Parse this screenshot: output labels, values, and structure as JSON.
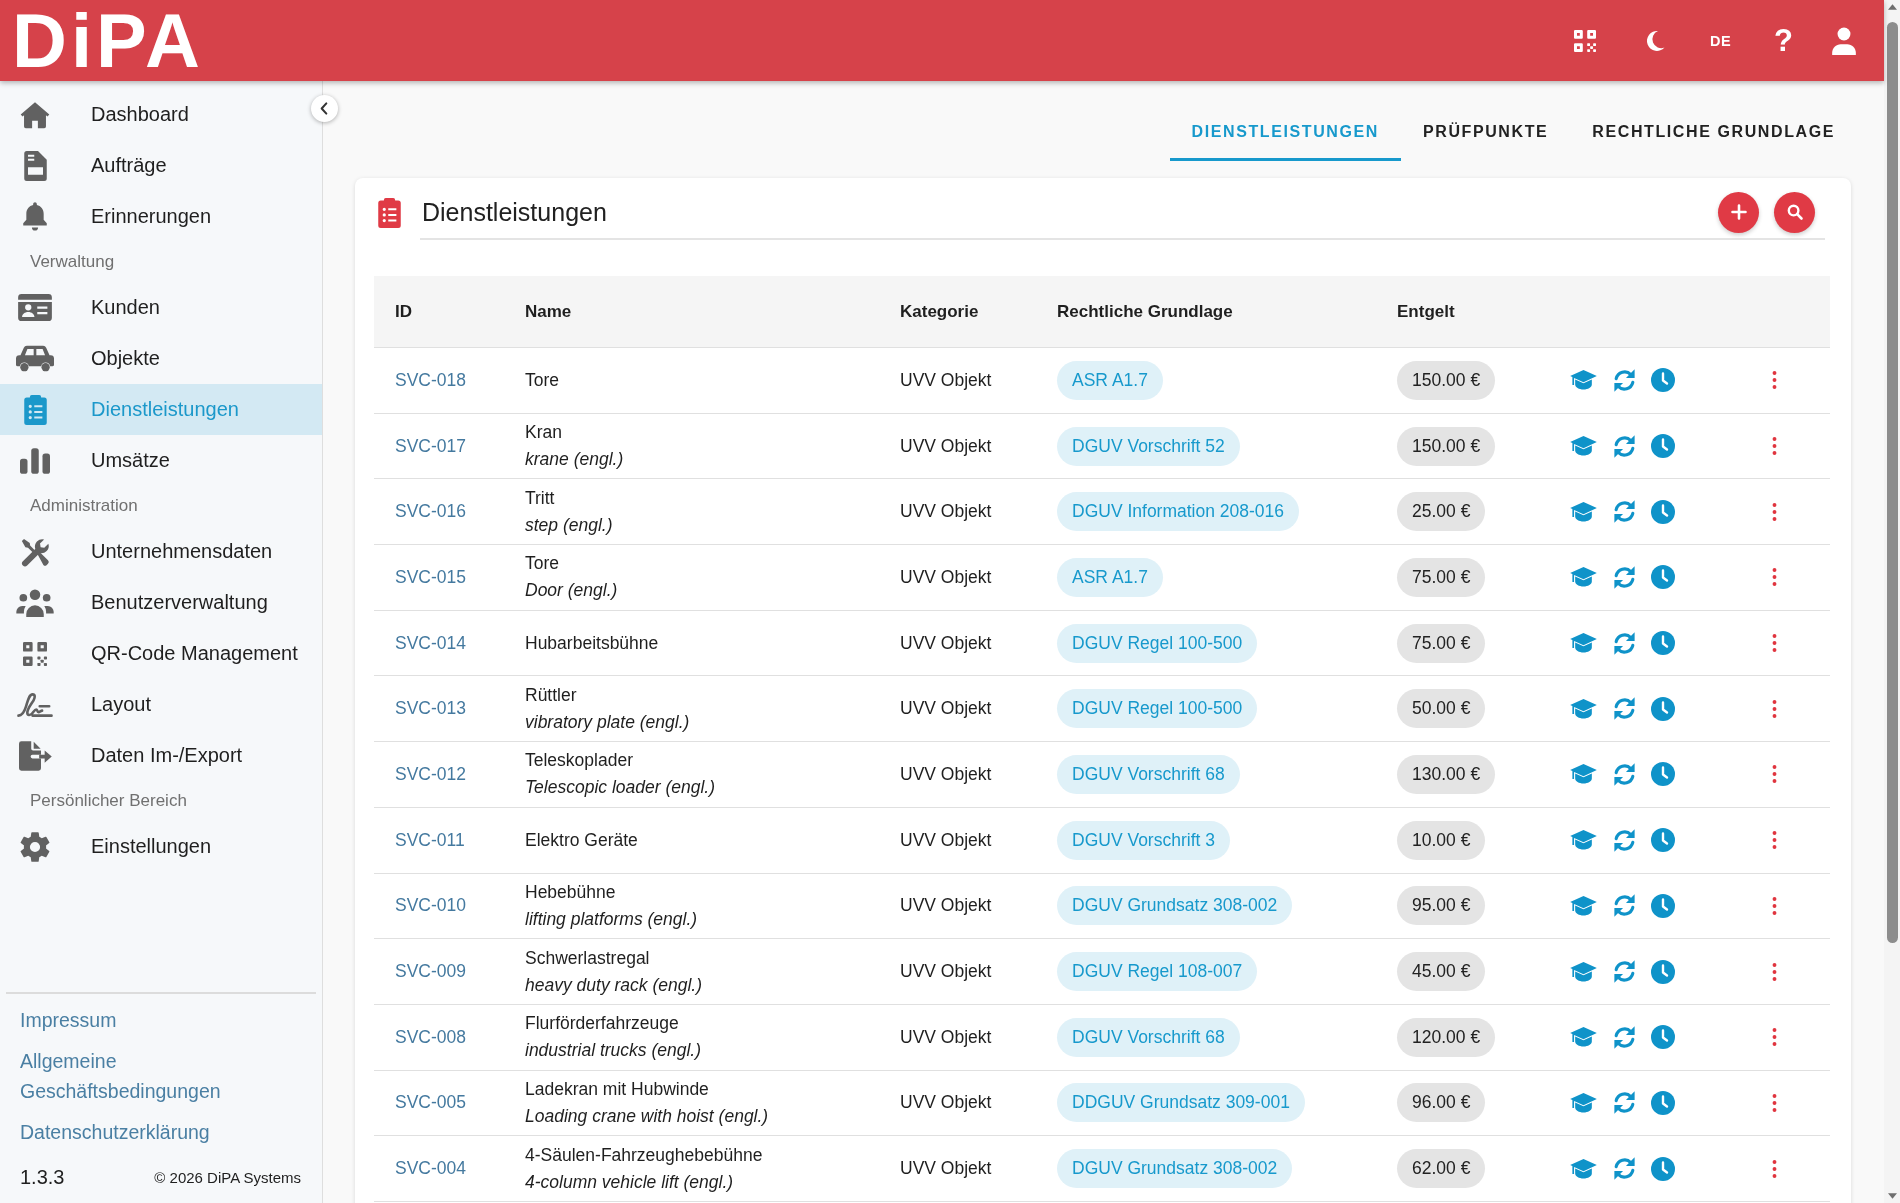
{
  "header": {
    "logo": "DiPA",
    "language": "DE",
    "help": "?"
  },
  "sidebar": {
    "sections": [
      {
        "items": [
          {
            "label": "Dashboard",
            "selected": false
          },
          {
            "label": "Aufträge",
            "selected": false
          },
          {
            "label": "Erinnerungen",
            "selected": false
          }
        ]
      },
      {
        "heading": "Verwaltung",
        "items": [
          {
            "label": "Kunden",
            "selected": false
          },
          {
            "label": "Objekte",
            "selected": false
          },
          {
            "label": "Dienstleistungen",
            "selected": true
          },
          {
            "label": "Umsätze",
            "selected": false
          }
        ]
      },
      {
        "heading": "Administration",
        "items": [
          {
            "label": "Unternehmensdaten",
            "selected": false
          },
          {
            "label": "Benutzerverwaltung",
            "selected": false
          },
          {
            "label": "QR-Code Management",
            "selected": false
          },
          {
            "label": "Layout",
            "selected": false
          },
          {
            "label": "Daten Im-/Export",
            "selected": false
          }
        ]
      },
      {
        "heading": "Persönlicher Bereich",
        "items": [
          {
            "label": "Einstellungen",
            "selected": false
          }
        ]
      }
    ],
    "footer_links": [
      "Impressum",
      "Allgemeine Geschäftsbedingungen",
      "Datenschutzerklärung"
    ],
    "version": "1.3.3",
    "copyright": "© 2026 DiPA Systems"
  },
  "tabs": [
    {
      "label": "DIENSTLEISTUNGEN",
      "selected": true
    },
    {
      "label": "PRÜFPUNKTE",
      "selected": false
    },
    {
      "label": "RECHTLICHE GRUNDLAGE",
      "selected": false
    }
  ],
  "card": {
    "title": "Dienstleistungen",
    "columns": [
      "ID",
      "Name",
      "Kategorie",
      "Rechtliche Grundlage",
      "Entgelt"
    ],
    "rows": [
      {
        "id": "SVC-018",
        "name": "Tore",
        "category": "UVV Objekt",
        "legal_basis": "ASR A1.7",
        "fee": "150.00 €"
      },
      {
        "id": "SVC-017",
        "name": "Kran",
        "name_en": "krane (engl.)",
        "category": "UVV Objekt",
        "legal_basis": "DGUV Vorschrift 52",
        "fee": "150.00 €"
      },
      {
        "id": "SVC-016",
        "name": "Tritt",
        "name_en": "step (engl.)",
        "category": "UVV Objekt",
        "legal_basis": "DGUV Information 208-016",
        "fee": "25.00 €"
      },
      {
        "id": "SVC-015",
        "name": "Tore",
        "name_en": "Door (engl.)",
        "category": "UVV Objekt",
        "legal_basis": "ASR A1.7",
        "fee": "75.00 €"
      },
      {
        "id": "SVC-014",
        "name": "Hubarbeitsbühne",
        "category": "UVV Objekt",
        "legal_basis": "DGUV Regel 100-500",
        "fee": "75.00 €"
      },
      {
        "id": "SVC-013",
        "name": "Rüttler",
        "name_en": "vibratory plate (engl.)",
        "category": "UVV Objekt",
        "legal_basis": "DGUV Regel 100-500",
        "fee": "50.00 €"
      },
      {
        "id": "SVC-012",
        "name": "Teleskoplader",
        "name_en": "Telescopic loader (engl.)",
        "category": "UVV Objekt",
        "legal_basis": "DGUV Vorschrift 68",
        "fee": "130.00 €"
      },
      {
        "id": "SVC-011",
        "name": "Elektro Geräte",
        "category": "UVV Objekt",
        "legal_basis": "DGUV Vorschrift 3",
        "fee": "10.00 €"
      },
      {
        "id": "SVC-010",
        "name": "Hebebühne",
        "name_en": "lifting platforms (engl.)",
        "category": "UVV Objekt",
        "legal_basis": "DGUV Grundsatz 308-002",
        "fee": "95.00 €"
      },
      {
        "id": "SVC-009",
        "name": "Schwerlastregal",
        "name_en": "heavy duty rack (engl.)",
        "category": "UVV Objekt",
        "legal_basis": "DGUV Regel 108-007",
        "fee": "45.00 €"
      },
      {
        "id": "SVC-008",
        "name": "Flurförderfahrzeuge",
        "name_en": "industrial trucks (engl.)",
        "category": "UVV Objekt",
        "legal_basis": "DGUV Vorschrift 68",
        "fee": "120.00 €"
      },
      {
        "id": "SVC-005",
        "name": "Ladekran mit Hubwinde",
        "name_en": "Loading crane with hoist (engl.)",
        "category": "UVV Objekt",
        "legal_basis": "DDGUV Grundsatz 309-001",
        "fee": "96.00 €"
      },
      {
        "id": "SVC-004",
        "name": "4-Säulen-Fahrzeughebebühne",
        "name_en": "4-column vehicle lift (engl.)",
        "category": "UVV Objekt",
        "legal_basis": "DGUV Grundsatz 308-002",
        "fee": "62.00 €"
      }
    ]
  }
}
